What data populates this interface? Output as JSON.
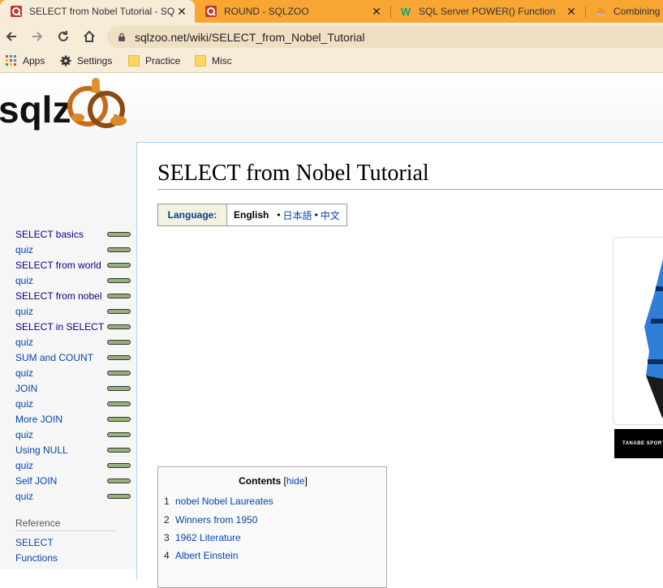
{
  "browser": {
    "tabs": [
      {
        "title": "SELECT from Nobel Tutorial - SQ",
        "favicon": "sqlzoo-icon",
        "active": true
      },
      {
        "title": "ROUND - SQLZOO",
        "favicon": "sqlzoo-icon",
        "active": false
      },
      {
        "title": "SQL Server POWER() Function",
        "favicon": "w3schools-icon",
        "active": false
      },
      {
        "title": "Combining '",
        "favicon": "stackoverflow-icon",
        "active": false
      }
    ],
    "url": "sqlzoo.net/wiki/SELECT_from_Nobel_Tutorial",
    "bookmarks": [
      {
        "label": "Apps",
        "icon": "apps-grid-icon"
      },
      {
        "label": "Settings",
        "icon": "gear-icon"
      },
      {
        "label": "Practice",
        "icon": "folder-icon"
      },
      {
        "label": "Misc",
        "icon": "folder-icon"
      }
    ],
    "colors": {
      "tabbar": "#f7a633",
      "toolbar": "#f7ecd8"
    }
  },
  "sidebar": {
    "items": [
      {
        "label": "SELECT basics"
      },
      {
        "label": "quiz"
      },
      {
        "label": "SELECT from world"
      },
      {
        "label": "quiz"
      },
      {
        "label": "SELECT from nobel"
      },
      {
        "label": "quiz"
      },
      {
        "label": "SELECT in SELECT"
      },
      {
        "label": "quiz"
      },
      {
        "label": "SUM and COUNT"
      },
      {
        "label": "quiz"
      },
      {
        "label": "JOIN"
      },
      {
        "label": "quiz"
      },
      {
        "label": "More JOIN"
      },
      {
        "label": "quiz"
      },
      {
        "label": "Using NULL"
      },
      {
        "label": "quiz"
      },
      {
        "label": "Self JOIN"
      },
      {
        "label": "quiz"
      }
    ],
    "reference_heading": "Reference",
    "reference_links": [
      "SELECT",
      "Functions"
    ]
  },
  "main": {
    "title": "SELECT from Nobel Tutorial",
    "language": {
      "label": "Language:",
      "current": "English",
      "others": [
        "日本語",
        "中文"
      ],
      "separator": "•"
    },
    "ad_text": "TANABE SPORTS",
    "toc": {
      "title": "Contents",
      "toggle": "hide",
      "items": [
        {
          "num": "1",
          "label": "nobel Nobel Laureates"
        },
        {
          "num": "2",
          "label": "Winners from 1950"
        },
        {
          "num": "3",
          "label": "1962 Literature"
        },
        {
          "num": "4",
          "label": "Albert Einstein"
        }
      ]
    }
  }
}
